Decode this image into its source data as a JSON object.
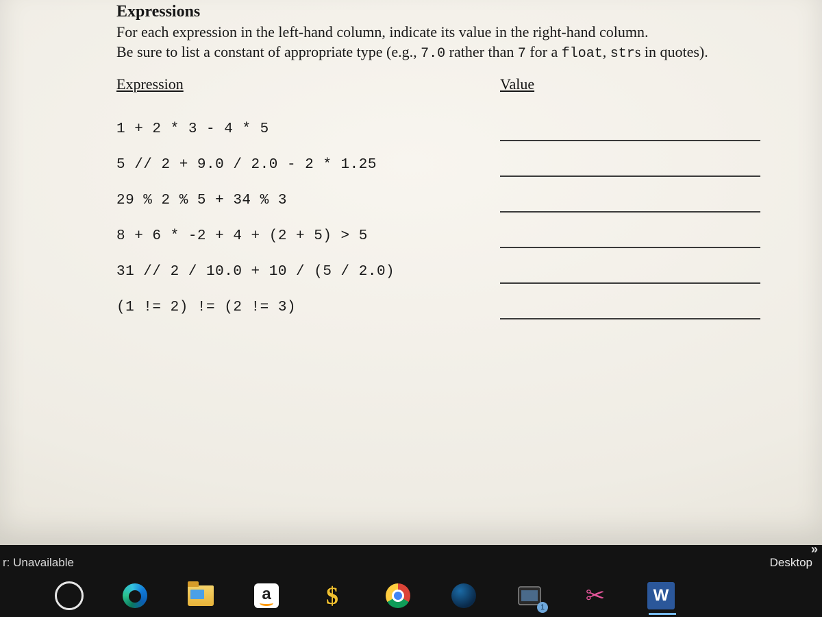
{
  "section": {
    "title": "Expressions",
    "instructions_1": "For each expression in the left-hand column, indicate its value in the right-hand column.",
    "instructions_2a": "Be sure to list a constant of appropriate type (e.g., ",
    "instructions_2b": "7.0",
    "instructions_2c": " rather than ",
    "instructions_2d": "7",
    "instructions_2e": " for a ",
    "instructions_2f": "float",
    "instructions_2g": ", ",
    "instructions_2h": "str",
    "instructions_2i": "s in quotes)."
  },
  "columns": {
    "left": "Expression",
    "right": "Value"
  },
  "expressions": {
    "r1": "1 + 2 * 3 - 4 * 5",
    "r2": "5 // 2 + 9.0 / 2.0 - 2 * 1.25",
    "r3": "29 % 2 % 5 + 34 % 3",
    "r4": "8 + 6 * -2 + 4 + (2 + 5) > 5",
    "r5": "31 // 2 / 10.0 + 10 / (5 / 2.0)",
    "r6": "(1 != 2) != (2 != 3)"
  },
  "taskbar": {
    "status": "r: Unavailable",
    "desktop": "Desktop",
    "chevrons": "»",
    "amazon": "a",
    "runelite": "$",
    "word": "W",
    "badge": "1",
    "snip": "✂"
  }
}
